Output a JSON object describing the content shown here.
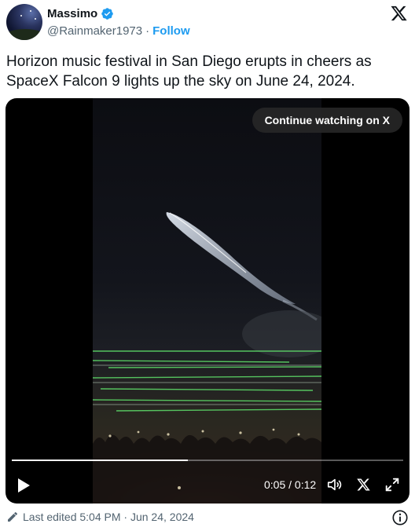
{
  "author": {
    "name": "Massimo",
    "handle": "@Rainmaker1973",
    "separator": "·",
    "follow_label": "Follow",
    "verified_color": "#1d9bf0"
  },
  "tweet": {
    "text": "Horizon music festival in San Diego erupts in cheers as SpaceX Falcon 9 lights up the sky on June 24, 2024."
  },
  "video": {
    "continue_label": "Continue watching on X",
    "time": "0:05 / 0:12",
    "progress_fraction": 0.45
  },
  "footer": {
    "edited_label": "Last edited 5:04 PM · Jun 24, 2024"
  },
  "icons": [
    "x-logo-icon",
    "verified-badge-icon",
    "play-icon",
    "volume-icon",
    "x-icon",
    "fullscreen-icon",
    "pencil-icon",
    "info-icon"
  ]
}
